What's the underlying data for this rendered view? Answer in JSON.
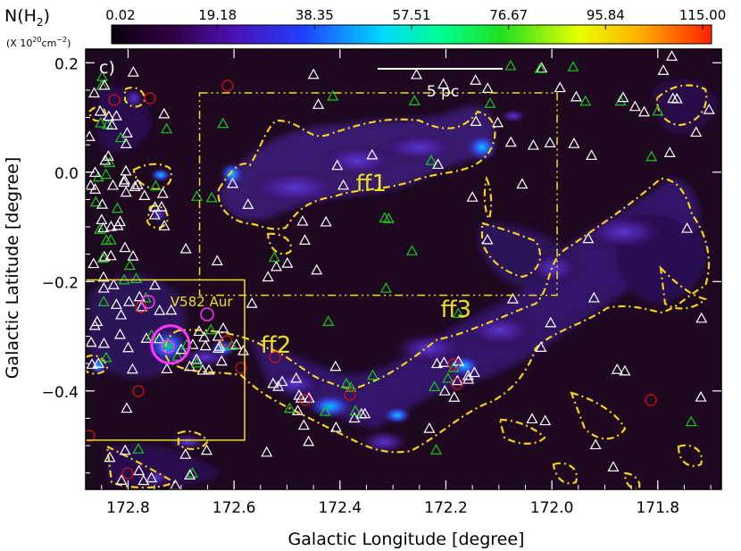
{
  "chart_data": {
    "type": "heatmap",
    "panel_label": "c)",
    "colorbar": {
      "title": "N(H",
      "title_sub": "2",
      "title_close": ")",
      "units": "(X 10",
      "units_exp": "20",
      "units_tail": "cm",
      "units_exp2": "−2",
      "units_close": ")",
      "ticks": [
        "0.02",
        "19.18",
        "38.35",
        "57.51",
        "76.67",
        "95.84",
        "115.00"
      ],
      "range": [
        0.02,
        115.0
      ]
    },
    "xlabel": "Galactic Longitude [degree]",
    "ylabel": "Galactic Latitude [degree]",
    "xlim": [
      172.88,
      171.68
    ],
    "ylim": [
      -0.58,
      0.225
    ],
    "x_ticks": [
      172.8,
      172.6,
      172.4,
      172.2,
      172.0,
      171.8
    ],
    "x_tick_labels": [
      "172.8",
      "172.6",
      "172.4",
      "172.2",
      "172.0",
      "171.8"
    ],
    "y_ticks": [
      0.2,
      0.0,
      -0.2,
      -0.4
    ],
    "y_tick_labels": [
      "0.2",
      "0.0",
      "−0.2",
      "−0.4"
    ],
    "scale_bar_label": "5 pc",
    "annotations": [
      {
        "text": "ff1",
        "l": 172.37,
        "b": -0.035
      },
      {
        "text": "ff2",
        "l": 172.55,
        "b": -0.33
      },
      {
        "text": "ff3",
        "l": 172.21,
        "b": -0.265
      },
      {
        "text": "V582 Aur",
        "l": 172.72,
        "b": -0.245
      }
    ],
    "boxes": [
      {
        "name": "box-ff1",
        "l_min": 171.99,
        "l_max": 172.665,
        "b_min": -0.225,
        "b_max": 0.145,
        "style": "dash-dot",
        "color": "#e8e020"
      },
      {
        "name": "box-v582",
        "l_min": 172.58,
        "l_max": 172.885,
        "b_min": -0.49,
        "b_max": -0.197,
        "style": "solid",
        "color": "#e8e020"
      }
    ],
    "source_circle": {
      "name": "V582 Aur",
      "l": 172.72,
      "b": -0.315,
      "color": "#ff33ff"
    },
    "colors": {
      "background": "#1e0920",
      "contour": "#f1d21e",
      "label": "#e8e020",
      "white_marker": "#ffffff",
      "green_marker": "#19c819",
      "red_marker": "#e01010",
      "magenta_marker": "#ff33ff"
    }
  }
}
